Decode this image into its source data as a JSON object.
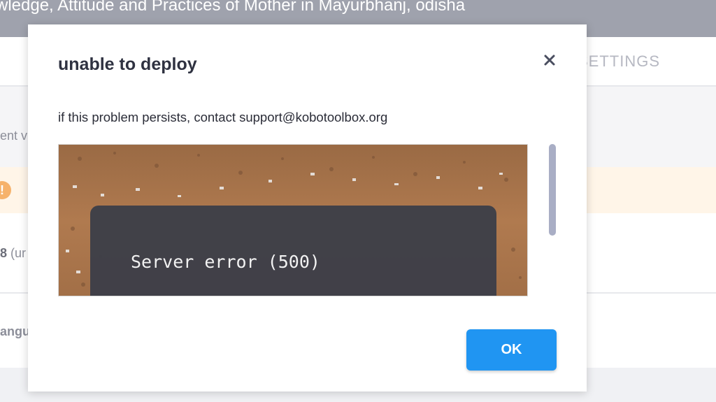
{
  "app": {
    "project_title": "wledge, Attitude and Practices of Mother in Mayurbhanj, odisha",
    "settings_tab": "SETTINGS",
    "row_a_text": "ent v",
    "row_b_bold": "8",
    "row_b_text": " (ur",
    "row_c_text": "angu"
  },
  "modal": {
    "title": "unable to deploy",
    "message": "if this problem persists, contact support@kobotoolbox.org",
    "error_text": "Server error (500)",
    "ok_label": "OK",
    "icons": {
      "close": "close-icon",
      "warning": "warning-icon"
    }
  },
  "colors": {
    "accent": "#2095f2",
    "header": "#9fa2ad",
    "warning_bg": "#fff5e8",
    "warning_icon": "#f6b26b"
  }
}
